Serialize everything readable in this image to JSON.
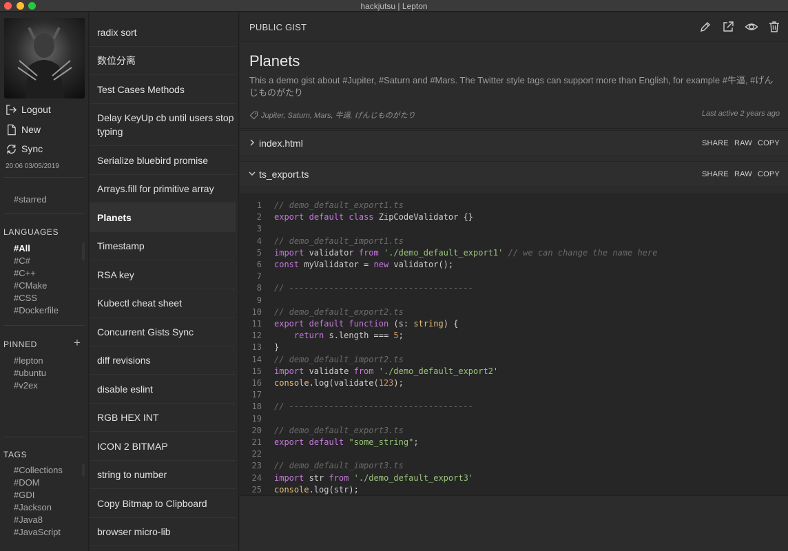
{
  "window": {
    "title": "hackjutsu | Lepton"
  },
  "nav": {
    "actions": [
      {
        "label": "Logout",
        "icon": "logout-icon"
      },
      {
        "label": "New",
        "icon": "new-file-icon"
      },
      {
        "label": "Sync",
        "icon": "sync-icon"
      }
    ],
    "sync_time": "20:06 03/05/2019",
    "starred": "#starred",
    "languages_title": "LANGUAGES",
    "languages": [
      "#All",
      "#C#",
      "#C++",
      "#CMake",
      "#CSS",
      "#Dockerfile"
    ],
    "active_language": "#All",
    "pinned_title": "PINNED",
    "pinned_add": "+",
    "pinned": [
      "#lepton",
      "#ubuntu",
      "#v2ex"
    ],
    "tags_title": "TAGS",
    "tags": [
      "#Collections",
      "#DOM",
      "#GDI",
      "#Jackson",
      "#Java8",
      "#JavaScript"
    ]
  },
  "gists": [
    "radix sort",
    "数位分离",
    "Test Cases Methods",
    "Delay KeyUp cb until users stop typing",
    "Serialize bluebird promise",
    "Arrays.fill for primitive array",
    "Planets",
    "Timestamp",
    "RSA key",
    "Kubectl cheat sheet",
    "Concurrent Gists Sync",
    "diff revisions",
    "disable eslint",
    "RGB HEX INT",
    "ICON 2 BITMAP",
    "string to number",
    "Copy Bitmap to Clipboard",
    "browser micro-lib"
  ],
  "active_gist": "Planets",
  "main": {
    "gist_type": "PUBLIC GIST",
    "toolbar_icons": [
      "edit-icon",
      "open-external-icon",
      "preview-eye-icon",
      "delete-trash-icon"
    ],
    "title": "Planets",
    "description": "This a demo gist about #Jupiter, #Saturn and #Mars. The Twitter style tags can support more than English, for example #牛逼, #げんじものがたり",
    "tags": "Jupiter, Saturn, Mars, 牛逼, げんじものがたり",
    "last_active": "Last active 2 years ago",
    "file_actions": [
      "SHARE",
      "RAW",
      "COPY"
    ],
    "files": [
      {
        "name": "index.html",
        "expanded": false
      },
      {
        "name": "ts_export.ts",
        "expanded": true
      }
    ],
    "code": [
      [
        [
          "cm",
          "// demo_default_export1.ts"
        ]
      ],
      [
        [
          "kw",
          "export"
        ],
        [
          "pl",
          " "
        ],
        [
          "kw",
          "default"
        ],
        [
          "pl",
          " "
        ],
        [
          "kw",
          "class"
        ],
        [
          "pl",
          " ZipCodeValidator {}"
        ]
      ],
      [],
      [
        [
          "cm",
          "// demo_default_import1.ts"
        ]
      ],
      [
        [
          "kw",
          "import"
        ],
        [
          "pl",
          " validator "
        ],
        [
          "kw",
          "from"
        ],
        [
          "pl",
          " "
        ],
        [
          "str",
          "'./demo_default_export1'"
        ],
        [
          "pl",
          " "
        ],
        [
          "cm",
          "// we can change the name here"
        ]
      ],
      [
        [
          "kw",
          "const"
        ],
        [
          "pl",
          " myValidator = "
        ],
        [
          "kw",
          "new"
        ],
        [
          "pl",
          " validator();"
        ]
      ],
      [],
      [
        [
          "cm",
          "// -------------------------------------"
        ]
      ],
      [],
      [
        [
          "cm",
          "// demo_default_export2.ts"
        ]
      ],
      [
        [
          "kw",
          "export"
        ],
        [
          "pl",
          " "
        ],
        [
          "kw",
          "default"
        ],
        [
          "pl",
          " "
        ],
        [
          "kw",
          "function"
        ],
        [
          "pl",
          " (s: "
        ],
        [
          "ty",
          "string"
        ],
        [
          "pl",
          ") {"
        ]
      ],
      [
        [
          "pl",
          "    "
        ],
        [
          "kw",
          "return"
        ],
        [
          "pl",
          " s.length === "
        ],
        [
          "num",
          "5"
        ],
        [
          "pl",
          ";"
        ]
      ],
      [
        [
          "pl",
          "}"
        ]
      ],
      [
        [
          "cm",
          "// demo_default_import2.ts"
        ]
      ],
      [
        [
          "kw",
          "import"
        ],
        [
          "pl",
          " validate "
        ],
        [
          "kw",
          "from"
        ],
        [
          "pl",
          " "
        ],
        [
          "str",
          "'./demo_default_export2'"
        ]
      ],
      [
        [
          "ty",
          "console"
        ],
        [
          "pl",
          ".log(validate("
        ],
        [
          "num",
          "123"
        ],
        [
          "pl",
          ");"
        ]
      ],
      [],
      [
        [
          "cm",
          "// -------------------------------------"
        ]
      ],
      [],
      [
        [
          "cm",
          "// demo_default_export3.ts"
        ]
      ],
      [
        [
          "kw",
          "export"
        ],
        [
          "pl",
          " "
        ],
        [
          "kw",
          "default"
        ],
        [
          "pl",
          " "
        ],
        [
          "str",
          "\"some_string\""
        ],
        [
          "pl",
          ";"
        ]
      ],
      [],
      [
        [
          "cm",
          "// demo_default_import3.ts"
        ]
      ],
      [
        [
          "kw",
          "import"
        ],
        [
          "pl",
          " str "
        ],
        [
          "kw",
          "from"
        ],
        [
          "pl",
          " "
        ],
        [
          "str",
          "'./demo_default_export3'"
        ]
      ],
      [
        [
          "ty",
          "console"
        ],
        [
          "pl",
          ".log(str);"
        ]
      ]
    ]
  },
  "colors": {
    "keyword": "#c678dd",
    "string": "#98c379",
    "number": "#d19a66",
    "comment": "#6b6b6b"
  }
}
